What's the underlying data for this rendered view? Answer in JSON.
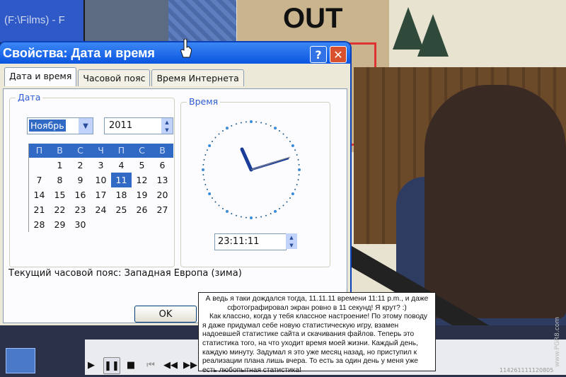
{
  "background": {
    "explorer_title": "(F:\\Films) - F",
    "sign_text": "OUT"
  },
  "dialog": {
    "title": "Свойства: Дата и время",
    "help_label": "?",
    "close_label": "✕",
    "tabs": [
      {
        "label": "Дата и время",
        "active": true
      },
      {
        "label": "Часовой пояс",
        "active": false
      },
      {
        "label": "Время Интернета",
        "active": false
      }
    ],
    "date_group": {
      "label": "Дата",
      "month": "Ноябрь",
      "year": "2011",
      "weekdays": [
        "П",
        "В",
        "С",
        "Ч",
        "П",
        "С",
        "В"
      ],
      "weeks": [
        [
          "",
          "1",
          "2",
          "3",
          "4",
          "5",
          "6"
        ],
        [
          "7",
          "8",
          "9",
          "10",
          "11",
          "12",
          "13"
        ],
        [
          "14",
          "15",
          "16",
          "17",
          "18",
          "19",
          "20"
        ],
        [
          "21",
          "22",
          "23",
          "24",
          "25",
          "26",
          "27"
        ],
        [
          "28",
          "29",
          "30",
          "",
          "",
          "",
          ""
        ]
      ],
      "selected_day": "11"
    },
    "time_group": {
      "label": "Время",
      "time_value": "23:11:11"
    },
    "timezone_text": "Текущий часовой пояс: Западная Европа (зима)",
    "ok_label": "OK",
    "accent_color": "#316ac5",
    "title_color": "#0a55e0"
  },
  "player": {
    "code": "114261111120805",
    "watermark": "www.PGR8.com",
    "controls": [
      "play-icon",
      "pause-icon",
      "stop-icon",
      "skip-back-icon",
      "rewind-icon",
      "fast-forward-icon"
    ]
  },
  "note": {
    "line1": "А ведь я таки дождался тогда, 11.11.11 времени 11:11 p.m., и даже сфотографировал экран ровно в 11 секунд! Я крут? :)",
    "line2": "Как классно, когда у тебя классное настроение! По этому поводу я даже придумал себе новую статистическую игру, взамен надоевшей статистике сайта и скачивания файлов. Теперь это статистика того, на что уходит время моей жизни. Каждый день, каждую минуту. Задумал я это уже месяц назад, но приступил к реализации плана лишь вчера. То есть за один день у меня уже есть любопытная статистика!"
  }
}
